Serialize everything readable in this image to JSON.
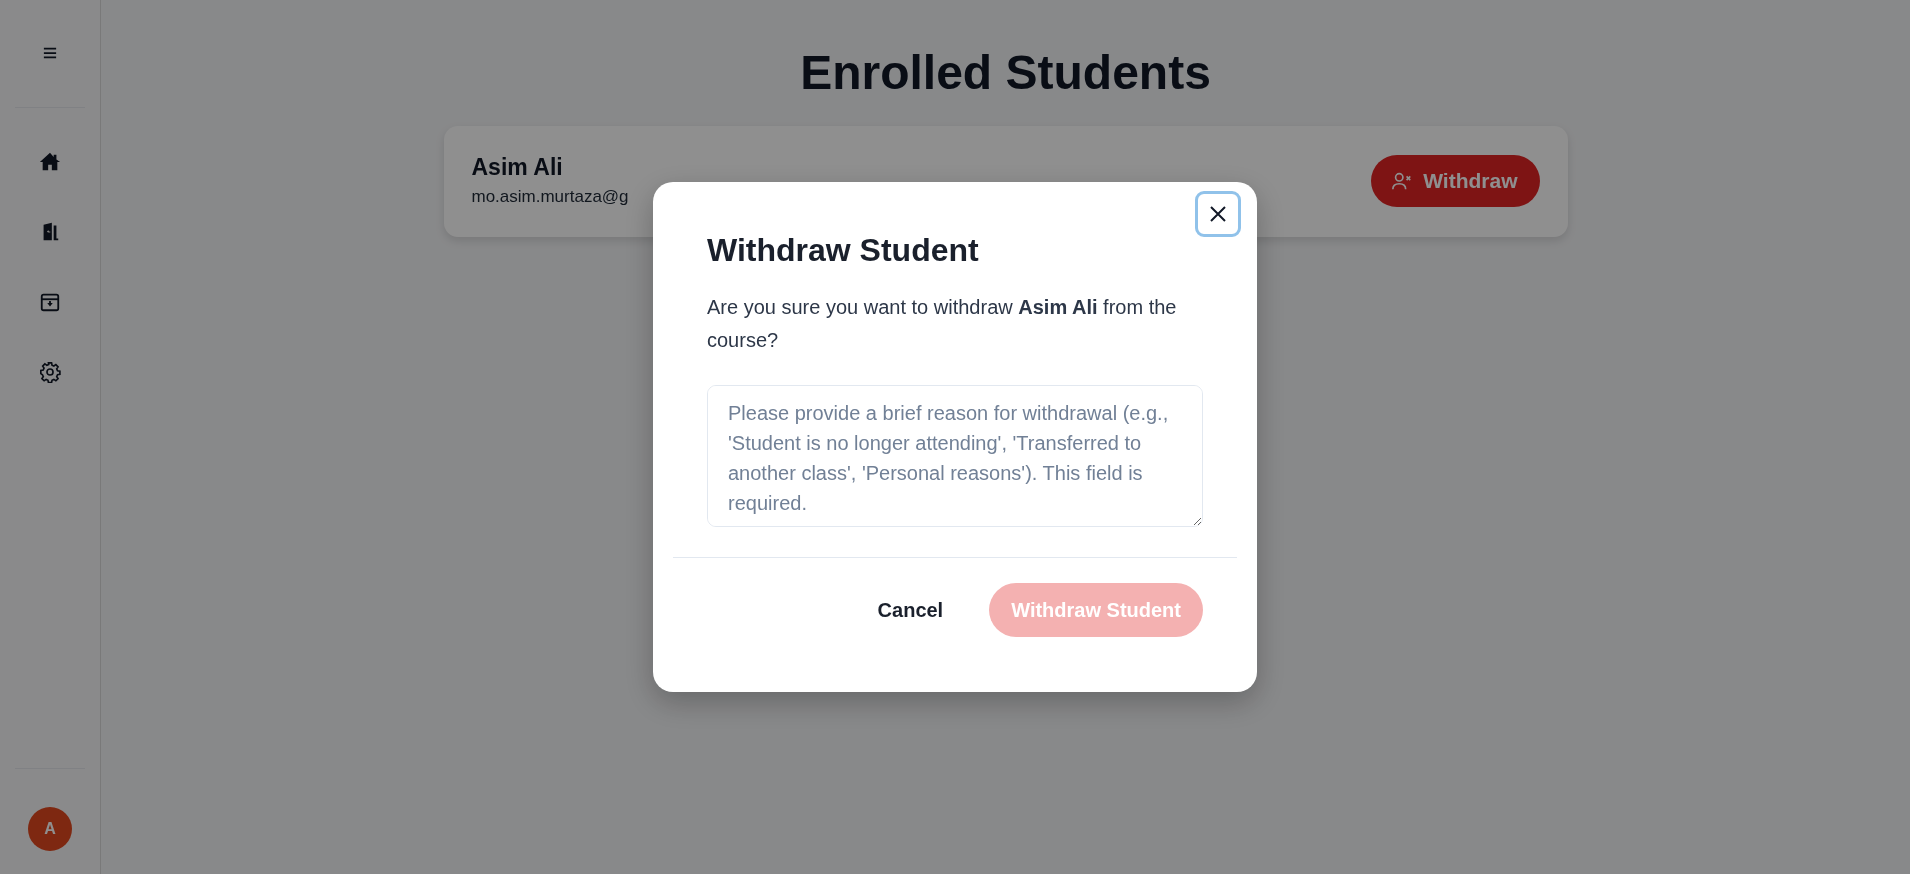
{
  "sidebar": {
    "items": [
      {
        "kind": "home",
        "selected": false
      },
      {
        "kind": "door",
        "selected": false
      },
      {
        "kind": "archive",
        "selected": false
      },
      {
        "kind": "settings",
        "selected": false
      }
    ],
    "avatar": "A"
  },
  "page": {
    "title": "Enrolled Students"
  },
  "students": [
    {
      "name": "Asim Ali",
      "email": "mo.asim.murtaza@g",
      "action": "Withdraw"
    }
  ],
  "dialog": {
    "title": "Withdraw Student",
    "message": "Are you sure you want to withdraw **Asim Ali** from the course?",
    "close_focused": true,
    "reason": {
      "placeholder": "Please provide a brief reason for withdrawal (e.g., 'Student is no longer attending', 'Transferred to another class', 'Personal reasons'). This field is required."
    },
    "buttons": [
      {
        "kind": "secondary",
        "label": "Cancel",
        "disabled": false
      },
      {
        "kind": "danger",
        "label": "Withdraw Student",
        "disabled": true
      }
    ]
  }
}
